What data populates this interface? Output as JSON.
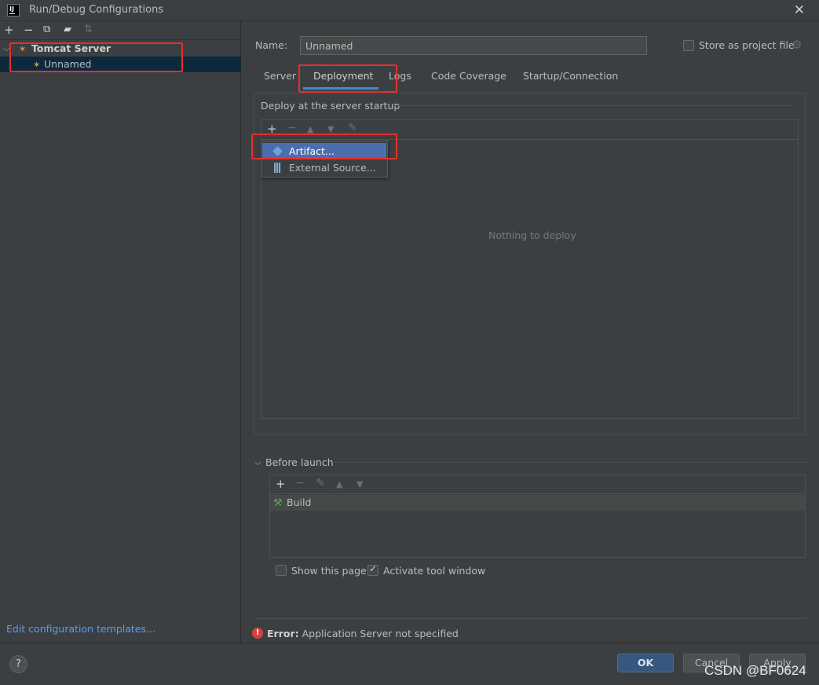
{
  "window": {
    "title": "Run/Debug Configurations",
    "app_icon_text": "IJ"
  },
  "left_panel": {
    "tree": {
      "group_label": "Tomcat Server",
      "item_label": "Unnamed"
    },
    "edit_templates_link": "Edit configuration templates..."
  },
  "config": {
    "name_label": "Name:",
    "name_value": "Unnamed",
    "store_label": "Store as project file",
    "store_checked": false
  },
  "tabs": [
    {
      "label": "Server",
      "active": false
    },
    {
      "label": "Deployment",
      "active": true
    },
    {
      "label": "Logs",
      "active": false
    },
    {
      "label": "Code Coverage",
      "active": false
    },
    {
      "label": "Startup/Connection",
      "active": false
    }
  ],
  "deployment": {
    "header": "Deploy at the server startup",
    "empty_text": "Nothing to deploy",
    "popup_items": [
      {
        "label": "Artifact...",
        "icon": "artifact-icon",
        "selected": true
      },
      {
        "label": "External Source...",
        "icon": "external-source-icon",
        "selected": false
      }
    ]
  },
  "before_launch": {
    "label": "Before launch",
    "tasks": [
      {
        "label": "Build",
        "icon": "hammer-icon"
      }
    ],
    "show_page_label": "Show this page",
    "show_page_checked": false,
    "activate_tool_label": "Activate tool window",
    "activate_tool_checked": true
  },
  "error": {
    "prefix": "Error:",
    "message": "Application Server not specified"
  },
  "buttons": {
    "help": "?",
    "ok": "OK",
    "cancel": "Cancel",
    "apply": "Apply"
  },
  "watermark": "CSDN @BF0624",
  "colors": {
    "background": "#3c3f41",
    "selection": "#0d293e",
    "popup_selection": "#4b6eaf",
    "tab_underline": "#4a88c7",
    "annotation_box": "#e62e2e",
    "error_icon": "#d94040",
    "ok_button": "#365880",
    "link": "#589df6"
  }
}
